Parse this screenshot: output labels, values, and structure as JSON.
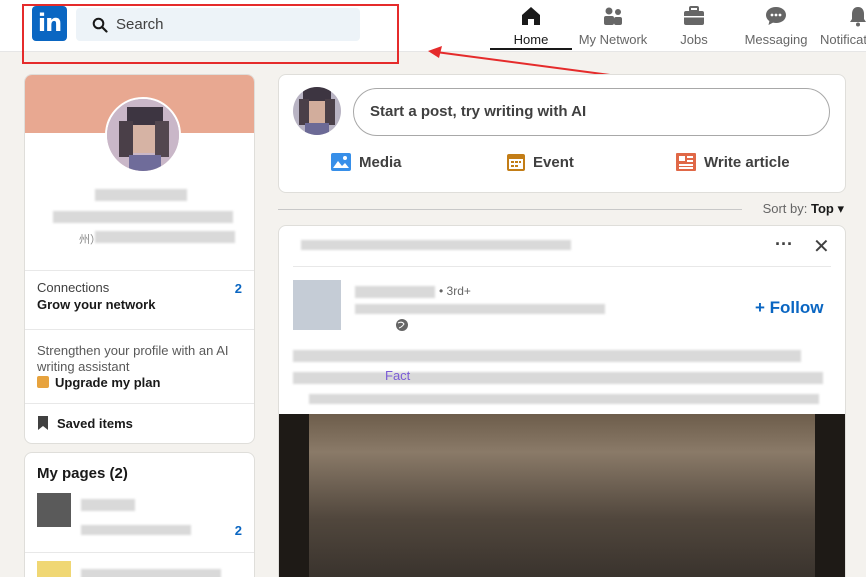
{
  "nav": {
    "search_placeholder": "Search",
    "items": [
      {
        "label": "Home",
        "icon": "home-icon",
        "active": true
      },
      {
        "label": "My Network",
        "icon": "network-icon",
        "active": false
      },
      {
        "label": "Jobs",
        "icon": "briefcase-icon",
        "active": false
      },
      {
        "label": "Messaging",
        "icon": "messaging-icon",
        "active": false
      },
      {
        "label": "Notifications",
        "icon": "bell-icon",
        "active": false
      }
    ]
  },
  "profile": {
    "location_fragment": "州）",
    "connections_label": "Connections",
    "connections_sub": "Grow your network",
    "connections_count": "2",
    "premium_text": "Strengthen your profile with an AI writing assistant",
    "premium_link": "Upgrade my plan",
    "saved_items": "Saved items"
  },
  "pages": {
    "title": "My pages (2)",
    "count": "2"
  },
  "composer": {
    "placeholder": "Start a post, try writing with AI",
    "actions": [
      {
        "label": "Media",
        "icon": "image-icon",
        "color": "#378fe9"
      },
      {
        "label": "Event",
        "icon": "calendar-icon",
        "color": "#c37d16"
      },
      {
        "label": "Write article",
        "icon": "article-icon",
        "color": "#e06847"
      }
    ]
  },
  "feed": {
    "sort_label": "Sort by:",
    "sort_value": "Top"
  },
  "post": {
    "degree": "• 3rd+",
    "follow_label": "+ Follow",
    "fact_text": "Fact"
  },
  "colors": {
    "brand": "#0a66c2",
    "annotation_red": "#e52b2b"
  }
}
